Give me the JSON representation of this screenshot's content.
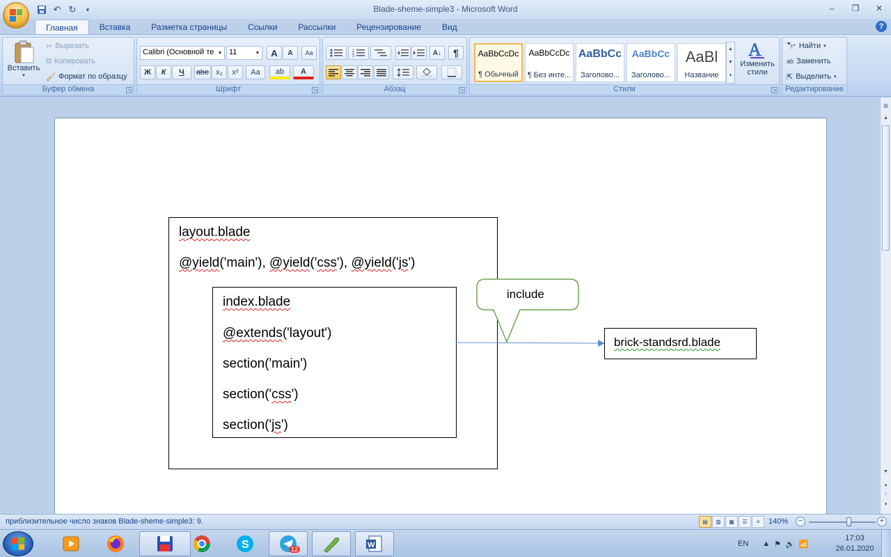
{
  "window": {
    "title": "Blade-sheme-simple3 - Microsoft Word",
    "controls": {
      "minimize": "–",
      "restore": "❐",
      "close": "✕"
    }
  },
  "qat": {
    "save_icon": "💾",
    "undo_icon": "↶",
    "redo_icon": "↻",
    "customize_icon": "▾"
  },
  "tabs": [
    {
      "label": "Главная",
      "active": true
    },
    {
      "label": "Вставка"
    },
    {
      "label": "Разметка страницы"
    },
    {
      "label": "Ссылки"
    },
    {
      "label": "Рассылки"
    },
    {
      "label": "Рецензирование"
    },
    {
      "label": "Вид"
    }
  ],
  "help": "?",
  "ribbon": {
    "clipboard": {
      "label": "Буфер обмена",
      "paste": "Вставить",
      "cut": "Вырезать",
      "copy": "Копировать",
      "format_painter": "Формат по образцу"
    },
    "font": {
      "label": "Шрифт",
      "font_name": "Calibri (Основной те",
      "font_size": "11",
      "grow": "A",
      "shrink": "A",
      "clear": "Aa",
      "bold": "Ж",
      "italic": "К",
      "underline": "Ч",
      "strike": "abe",
      "subscript": "x₂",
      "superscript": "x²",
      "case": "Aa",
      "highlight": "ab",
      "color": "A"
    },
    "paragraph": {
      "label": "Абзац",
      "pilcrow": "¶"
    },
    "styles": {
      "label": "Стили",
      "items": [
        {
          "sample": "AaBbCcDc",
          "name": "¶ Обычный",
          "selected": true
        },
        {
          "sample": "AaBbCcDc",
          "name": "¶ Без инте..."
        },
        {
          "sample": "AaBbCc",
          "name": "Заголово..."
        },
        {
          "sample": "AaBbCc",
          "name": "Заголово..."
        },
        {
          "sample": "AaBl",
          "name": "Название"
        }
      ],
      "change_styles_line1": "Изменить",
      "change_styles_line2": "стили"
    },
    "editing": {
      "label": "Редактирование",
      "find": "Найти",
      "replace": "Заменить",
      "select": "Выделить"
    }
  },
  "document": {
    "layout_title": "layout.blade",
    "yield_kw1": "@yield",
    "yield_arg1": "('main'), ",
    "yield_kw2": "@yield",
    "yield_arg2a": "('",
    "yield_arg2b": "css",
    "yield_arg2c": "'), ",
    "yield_kw3": "@yield",
    "yield_arg3a": "('",
    "yield_arg3b": "js",
    "yield_arg3c": "')",
    "index_title": "index.blade",
    "extends_kw": "@extends",
    "extends_arg": "('layout')",
    "section_main": "section('main')",
    "section_css_a": "section('",
    "section_css_b": "css",
    "section_css_c": "')",
    "section_js_a": "section('",
    "section_js_b": "js",
    "section_js_c": "')",
    "callout": "include",
    "brick": "brick-standsrd.blade"
  },
  "status": {
    "text": "приблизительное число знаков Blade-sheme-simple3: 9.",
    "zoom": "140%",
    "zoom_level": 0.6
  },
  "taskbar": {
    "lang": "EN",
    "time": "17:03",
    "date": "26.01.2020",
    "telegram_badge": "12"
  }
}
